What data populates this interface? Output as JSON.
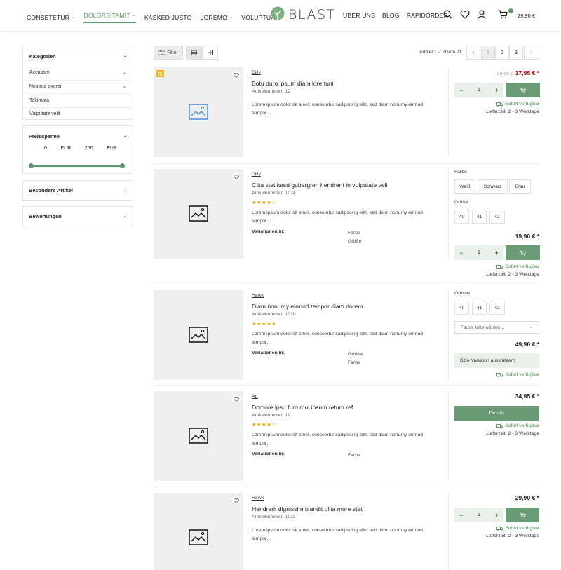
{
  "header": {
    "nav_left": [
      {
        "label": "CONSETETUR",
        "has_dropdown": true,
        "active": false
      },
      {
        "label": "DOLORSITAMIT",
        "has_dropdown": true,
        "active": true
      },
      {
        "label": "KASKED JUSTO",
        "has_dropdown": false,
        "active": false
      },
      {
        "label": "LOREMO",
        "has_dropdown": true,
        "active": false
      },
      {
        "label": "VOLUPTUA",
        "has_dropdown": false,
        "active": false
      }
    ],
    "logo_text": "BLAST",
    "nav_right": [
      {
        "label": "ÜBER UNS"
      },
      {
        "label": "BLOG"
      },
      {
        "label": "RAPIDORDER"
      }
    ],
    "cart_total": "29,90 €",
    "accent_color": "#5e9a6a"
  },
  "sidebar": {
    "categories": {
      "title": "Kategorien",
      "items": [
        {
          "label": "Accusam",
          "expandable": true
        },
        {
          "label": "Nostrud exerci",
          "expandable": true
        },
        {
          "label": "Takimata",
          "expandable": false
        },
        {
          "label": "Vulputate velit",
          "expandable": false
        }
      ]
    },
    "price": {
      "title": "Preisspanne",
      "min_value": "0",
      "min_currency": "EUR",
      "max_value": "250",
      "max_currency": "EUR"
    },
    "special": {
      "title": "Besondere Artikel"
    },
    "ratings": {
      "title": "Bewertungen"
    }
  },
  "toolbar": {
    "filter_label": "Filter",
    "pagination_info": "Artikel 1 - 10 von 21",
    "pages": [
      "1",
      "2",
      "3"
    ],
    "current_page": "1"
  },
  "products": [
    {
      "brand": "Dilly",
      "title": "Botu duro ipsum diam lore tuni",
      "number": "Artikelnummer: 12",
      "stars": "",
      "description": "Lorem ipsum dolor sit amet, consetetur sadipscing elitr, sed diam nonumy eirmod tempor…",
      "old_price": "19,90 €",
      "price": "17,95 € *",
      "qty": "1",
      "availability": "Sofort verfügbar",
      "delivery": "Lieferzeit: 2 - 3 Werktage"
    },
    {
      "brand": "Dilly",
      "title": "Clita stet kasd gubergren hendrerit in vulputate veli",
      "number": "Artikelnummer: 1024",
      "stars": "★★★★☆",
      "description": "Lorem ipsum dolor sit amet, consetetur sadipscing elitr, sed diam nonumy eirmod tempor…",
      "variations_label": "Variationen in:",
      "variations": [
        "Farbe",
        "Größe"
      ],
      "option_group_1_label": "Farbe",
      "option_group_1": [
        "Weiß",
        "Schwarz",
        "Blau"
      ],
      "option_group_2_label": "Größe",
      "option_group_2": [
        "40",
        "41",
        "42"
      ],
      "price": "19,90 € *",
      "qty": "1",
      "availability": "Sofort verfügbar",
      "delivery": "Lieferzeit: 2 - 3 Werktage"
    },
    {
      "brand": "Hawk",
      "title": "Diam nonumy eirmod tempor diam dorem",
      "number": "Artikelnummer: 1020",
      "stars": "★★★★★",
      "description": "Lorem ipsum dolor sit amet, consetetur sadipscing elitr, sed diam nonumy eirmod tempor…",
      "variations_label": "Variationen in:",
      "variations": [
        "Grösse",
        "Farbe"
      ],
      "option_group_1_label": "Grösse",
      "option_group_1": [
        "40",
        "41",
        "42"
      ],
      "select_placeholder": "Farbe, bitte wählen…",
      "price": "49,90 € *",
      "hint": "Bitte Variation auswählen!",
      "availability": "Sofort verfügbar"
    },
    {
      "brand": "Art",
      "title": "Domore ipsu furo mui ipsum retum ref",
      "number": "Artikelnummer: 11",
      "stars": "★★★★☆",
      "description": "Lorem ipsum dolor sit amet, consetetur sadipscing elitr, sed diam nonumy eirmod tempor…",
      "variations_label": "Variationen in:",
      "variations": [
        "Farbe"
      ],
      "price": "34,95 € *",
      "details_label": "Details",
      "availability": "Sofort verfügbar",
      "delivery": "Lieferzeit: 2 - 3 Werktage"
    },
    {
      "brand": "Hawk",
      "title": "Hendrerit dignissim blandit plita more stet",
      "number": "Artikelnummer: 1023",
      "stars": "",
      "description": "Lorem ipsum dolor sit amet, consetetur sadipscing elitr, sed diam nonumy eirmod tempor…",
      "price": "29,90 € *",
      "qty": "1",
      "availability": "Sofort verfügbar",
      "delivery": "Lieferzeit: 2 - 3 Werktage"
    }
  ]
}
